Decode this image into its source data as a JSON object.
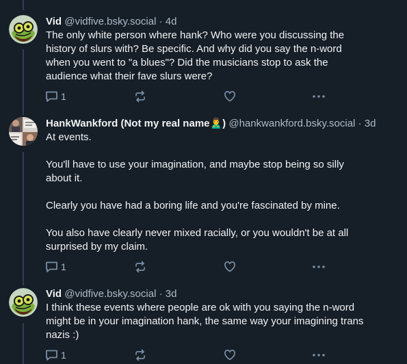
{
  "posts": [
    {
      "author_name": "Vid",
      "handle": "@vidfive.bsky.social",
      "separator": "·",
      "time": "4d",
      "paragraphs": [
        "The only white person where hank? Who were you discussing the",
        "history of slurs with? Be specific. And why did you say the n-word",
        "when you went to \"a blues\"? Did the musicians stop to ask the",
        "audience what their fave slurs were?"
      ],
      "reply_count": "1",
      "avatar": "green-frog-avatar"
    },
    {
      "author_name": "HankWankford (Not my real name🙎‍♂️)",
      "handle": "@hankwankford.bsky.social",
      "separator": "·",
      "time": "3d",
      "paragraphs": [
        "At events.",
        "You'll have to use your imagination, and maybe stop being so silly",
        "about it.",
        "Clearly you have had a boring life and you're fascinated by mine.",
        "You also have clearly never mixed racially, or you wouldn't be at all",
        "surprised by my claim."
      ],
      "reply_count": "1",
      "avatar": "photo-collage-avatar"
    },
    {
      "author_name": "Vid",
      "handle": "@vidfive.bsky.social",
      "separator": "·",
      "time": "3d",
      "paragraphs": [
        "I think these events where people are ok with you saying the n-word",
        "might be in your imagination hank, the same way your imagining trans",
        "nazis :)"
      ],
      "reply_count": "1",
      "avatar": "green-frog-avatar"
    }
  ],
  "icons": {
    "reply": "reply-icon",
    "repost": "repost-icon",
    "like": "heart-icon",
    "more": "more-options-icon"
  },
  "colors": {
    "background": "#161e27",
    "text": "#f1f3f5",
    "secondary_text": "#aebbc9",
    "icon": "#788ea5",
    "thread_line": "#2e4052"
  }
}
